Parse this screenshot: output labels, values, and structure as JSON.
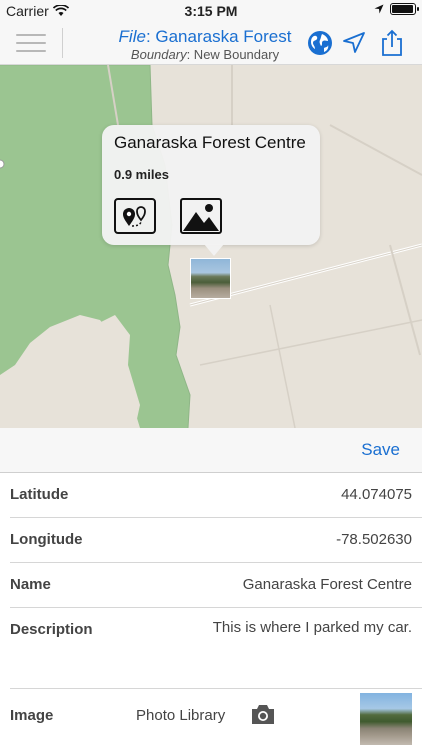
{
  "status_bar": {
    "carrier": "Carrier",
    "time": "3:15 PM",
    "battery_level": 0.95
  },
  "nav": {
    "file_prefix": "File",
    "file_name": ": Ganaraska Forest",
    "boundary_prefix": "Boundary",
    "boundary_name": ": New Boundary",
    "icons": [
      "menu-icon",
      "globe-icon",
      "location-arrow-icon",
      "share-icon"
    ],
    "accent_color": "#1a6fd1"
  },
  "map": {
    "callout": {
      "title": "Ganaraska Forest Centre",
      "distance": "0.9 miles"
    }
  },
  "sheet": {
    "save_label": "Save",
    "fields": {
      "latitude": {
        "label": "Latitude",
        "value": "44.074075"
      },
      "longitude": {
        "label": "Longitude",
        "value": "-78.502630"
      },
      "name": {
        "label": "Name",
        "value": "Ganaraska Forest Centre"
      },
      "description": {
        "label": "Description",
        "value": "This is where I parked my car."
      },
      "image": {
        "label": "Image",
        "photo_library": "Photo Library"
      }
    }
  }
}
